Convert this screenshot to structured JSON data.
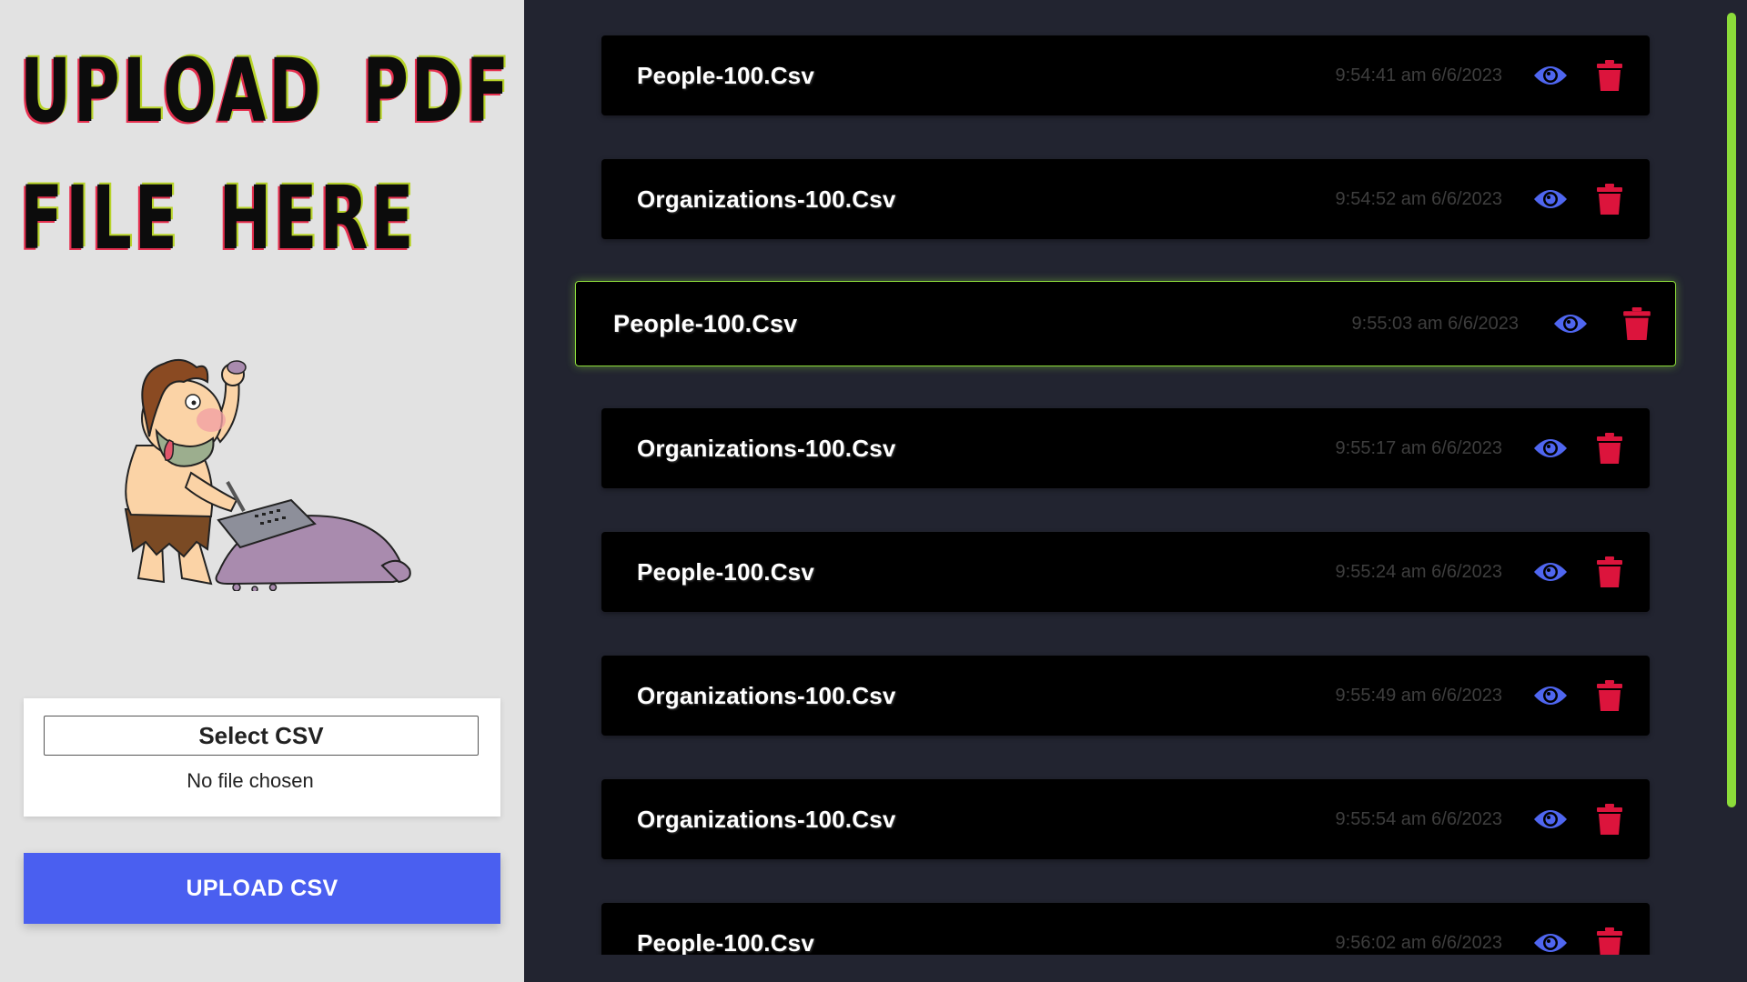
{
  "left_panel": {
    "heading_line1": "UPLOAD PDF",
    "heading_line2": "FILE HERE",
    "illustration": "caveman-carving-tablet",
    "select_button_label": "Select CSV",
    "no_file_text": "No file chosen",
    "upload_button_label": "UPLOAD CSV"
  },
  "files": [
    {
      "name": "People-100.Csv",
      "time": "9:54:41 am 6/6/2023"
    },
    {
      "name": "Organizations-100.Csv",
      "time": "9:54:52 am 6/6/2023"
    },
    {
      "name": "People-100.Csv",
      "time": "9:55:03 am 6/6/2023",
      "active": true
    },
    {
      "name": "Organizations-100.Csv",
      "time": "9:55:17 am 6/6/2023"
    },
    {
      "name": "People-100.Csv",
      "time": "9:55:24 am 6/6/2023"
    },
    {
      "name": "Organizations-100.Csv",
      "time": "9:55:49 am 6/6/2023"
    },
    {
      "name": "Organizations-100.Csv",
      "time": "9:55:54 am 6/6/2023"
    },
    {
      "name": "People-100.Csv",
      "time": "9:56:02 am 6/6/2023"
    }
  ],
  "icons": {
    "view": "eye-icon",
    "delete": "trash-icon"
  },
  "colors": {
    "accent_blue": "#4a5ff0",
    "view_icon": "#4f66f0",
    "delete_icon": "#dc143c",
    "active_border": "#8cdc3a",
    "scrollbar": "#8cdc3a",
    "right_bg": "#222430",
    "left_bg": "#e2e2e2"
  }
}
